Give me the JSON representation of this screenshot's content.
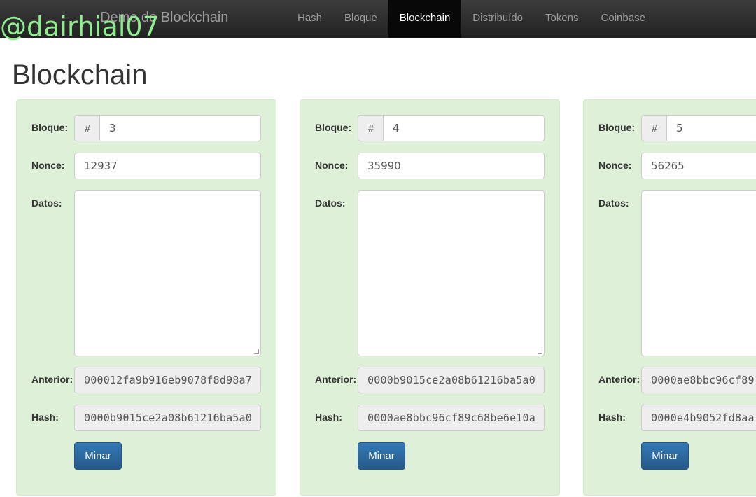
{
  "nav": {
    "brand": "Demo de Blockchain",
    "items": [
      {
        "label": "Hash",
        "active": false
      },
      {
        "label": "Bloque",
        "active": false
      },
      {
        "label": "Blockchain",
        "active": true
      },
      {
        "label": "Distribuído",
        "active": false
      },
      {
        "label": "Tokens",
        "active": false
      },
      {
        "label": "Coinbase",
        "active": false
      }
    ]
  },
  "watermark": "@dairhial07",
  "page": {
    "title": "Blockchain"
  },
  "labels": {
    "block": "Bloque:",
    "nonce": "Nonce:",
    "data": "Datos:",
    "previous": "Anterior:",
    "hash": "Hash:",
    "mine_button": "Minar",
    "hash_symbol": "#"
  },
  "blocks": [
    {
      "number": "3",
      "nonce": "12937",
      "data": "",
      "previous": "000012fa9b916eb9078f8d98a7",
      "hash": "0000b9015ce2a08b61216ba5a0"
    },
    {
      "number": "4",
      "nonce": "35990",
      "data": "",
      "previous": "0000b9015ce2a08b61216ba5a0",
      "hash": "0000ae8bbc96cf89c68be6e10a"
    },
    {
      "number": "5",
      "nonce": "56265",
      "data": "",
      "previous": "0000ae8bbc96cf89",
      "hash": "0000e4b9052fd8aa"
    }
  ]
}
